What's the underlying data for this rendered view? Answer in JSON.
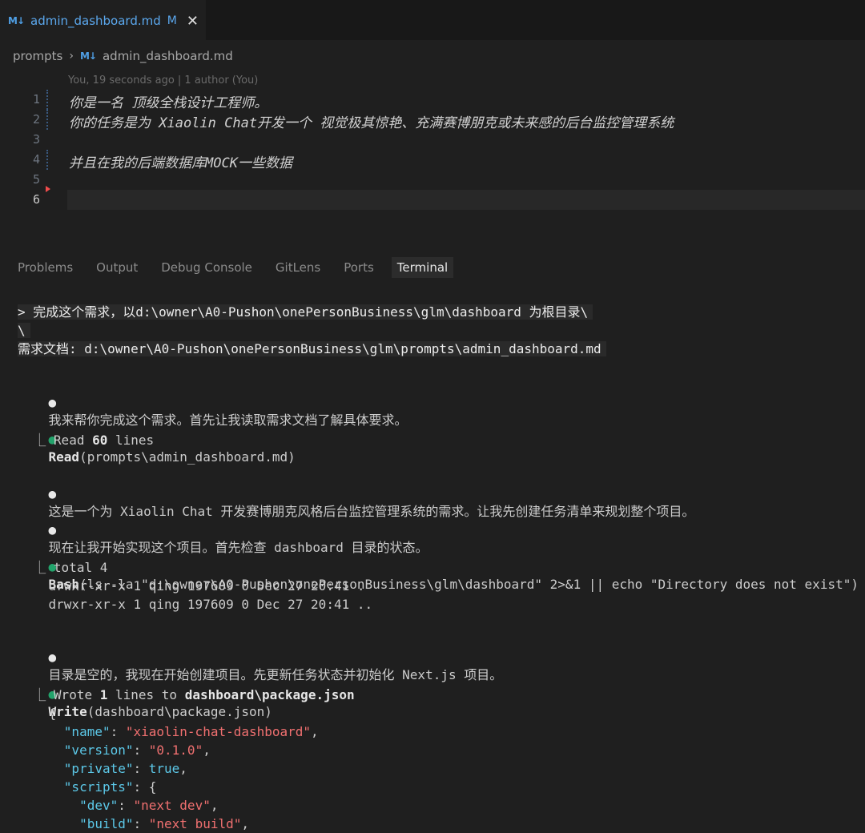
{
  "tab": {
    "icon": "M↓",
    "title": "admin_dashboard.md",
    "modified": "M",
    "close": "✕"
  },
  "breadcrumb": {
    "folder": "prompts",
    "separator": "›",
    "file": "admin_dashboard.md"
  },
  "editor": {
    "blame": "You, 19 seconds ago | 1 author (You)",
    "lines": [
      {
        "num": "1",
        "text": "你是一名 顶级全栈设计工程师。"
      },
      {
        "num": "2",
        "text": "你的任务是为 Xiaolin Chat开发一个 视觉极其惊艳、充满赛博朋克或未来感的后台监控管理系统"
      },
      {
        "num": "3",
        "text": ""
      },
      {
        "num": "4",
        "text": "并且在我的后端数据库MOCK一些数据"
      },
      {
        "num": "5",
        "text": ""
      },
      {
        "num": "6",
        "text": ""
      }
    ]
  },
  "panel": {
    "tabs": [
      "Problems",
      "Output",
      "Debug Console",
      "GitLens",
      "Ports",
      "Terminal"
    ],
    "active": "Terminal"
  },
  "terminal": {
    "prompt_line1": "> 完成这个需求，以d:\\owner\\A0-Pushon\\onePersonBusiness\\glm\\dashboard 为根目录\\",
    "prompt_line2": "\\",
    "prompt_line3": "需求文档: d:\\owner\\A0-Pushon\\onePersonBusiness\\glm\\prompts\\admin_dashboard.md",
    "msg1": "我来帮你完成这个需求。首先让我读取需求文档了解具体要求。",
    "read_tool": "Read",
    "read_args": "(prompts\\admin_dashboard.md)",
    "read_result_pre": "Read ",
    "read_result_num": "60",
    "read_result_post": " lines",
    "msg2": "这是一个为 Xiaolin Chat 开发赛博朋克风格后台监控管理系统的需求。让我先创建任务清单来规划整个项目。",
    "msg3": "现在让我开始实现这个项目。首先检查 dashboard 目录的状态。",
    "bash_tool": "Bash",
    "bash_args": "(ls -la \"d:\\owner\\A0-Pushon\\onePersonBusiness\\glm\\dashboard\" 2>&1 || echo \"Directory does not exist\")",
    "bash_out1": "total 4",
    "bash_out2": "drwxr-xr-x 1 qing 197609 0 Dec 27 20:41 .",
    "bash_out3": "drwxr-xr-x 1 qing 197609 0 Dec 27 20:41 ..",
    "msg4": "目录是空的，我现在开始创建项目。先更新任务状态并初始化 Next.js 项目。",
    "write_tool": "Write",
    "write_args": "(dashboard\\package.json)",
    "write_pre": "Wrote ",
    "write_num": "1",
    "write_mid": " lines to ",
    "write_file": "dashboard\\package.json",
    "json_open": "{",
    "k_name": "\"name\"",
    "v_name": "\"xiaolin-chat-dashboard\"",
    "k_version": "\"version\"",
    "v_version": "\"0.1.0\"",
    "k_private": "\"private\"",
    "v_private": "true",
    "k_scripts": "\"scripts\"",
    "k_dev": "\"dev\"",
    "v_dev": "\"next dev\"",
    "k_build": "\"build\"",
    "v_build": "\"next build\"",
    "bullet": "●",
    "branch": "⎿"
  }
}
